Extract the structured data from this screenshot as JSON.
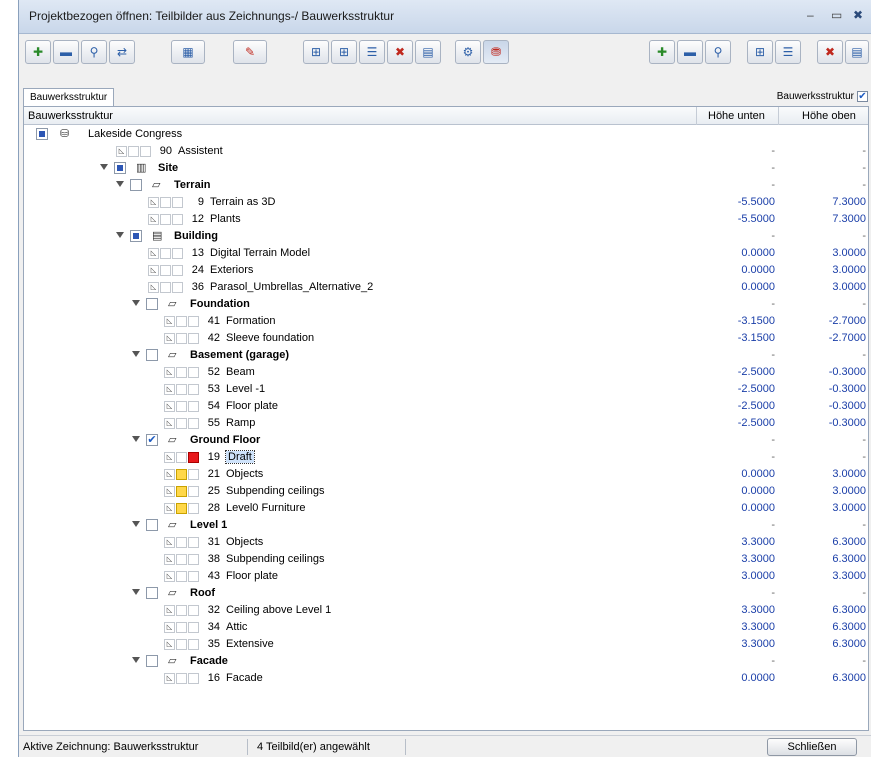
{
  "window": {
    "title": "Projektbezogen öffnen: Teilbilder aus Zeichnungs-/ Bauwerksstruktur",
    "minimize": "–",
    "maximize": "▭",
    "close": "✖"
  },
  "tabs": {
    "active": "Bauwerksstruktur",
    "right_label": "Bauwerksstruktur",
    "right_checked": "✔"
  },
  "columns": {
    "name": "Bauwerksstruktur",
    "low": "Höhe unten",
    "high": "Höhe oben"
  },
  "tree": [
    {
      "kind": "root",
      "label": "Lakeside Congress",
      "low": "",
      "high": ""
    },
    {
      "kind": "leaf",
      "level": 1,
      "num": "90",
      "label": "Assistent",
      "low": "-",
      "high": "-"
    },
    {
      "kind": "node",
      "level": 1,
      "label": "Site",
      "check": "filled",
      "low": "-",
      "high": "-"
    },
    {
      "kind": "node",
      "level": 2,
      "label": "Terrain",
      "check": "empty",
      "low": "-",
      "high": "-"
    },
    {
      "kind": "leaf",
      "level": 3,
      "num": "9",
      "label": "Terrain as 3D",
      "low": "-5.5000",
      "high": "7.3000"
    },
    {
      "kind": "leaf",
      "level": 3,
      "num": "12",
      "label": "Plants",
      "low": "-5.5000",
      "high": "7.3000"
    },
    {
      "kind": "node",
      "level": 2,
      "label": "Building",
      "check": "filled",
      "low": "-",
      "high": "-"
    },
    {
      "kind": "leaf",
      "level": 3,
      "num": "13",
      "label": "Digital Terrain Model",
      "low": "0.0000",
      "high": "3.0000"
    },
    {
      "kind": "leaf",
      "level": 3,
      "num": "24",
      "label": "Exteriors",
      "low": "0.0000",
      "high": "3.0000"
    },
    {
      "kind": "leaf",
      "level": 3,
      "num": "36",
      "label": "Parasol_Umbrellas_Alternative_2",
      "low": "0.0000",
      "high": "3.0000"
    },
    {
      "kind": "node",
      "level": 3,
      "label": "Foundation",
      "check": "empty",
      "low": "-",
      "high": "-"
    },
    {
      "kind": "leaf",
      "level": 4,
      "num": "41",
      "label": "Formation",
      "low": "-3.1500",
      "high": "-2.7000"
    },
    {
      "kind": "leaf",
      "level": 4,
      "num": "42",
      "label": "Sleeve foundation",
      "low": "-3.1500",
      "high": "-2.7000"
    },
    {
      "kind": "node",
      "level": 3,
      "label": "Basement (garage)",
      "check": "empty",
      "low": "-",
      "high": "-"
    },
    {
      "kind": "leaf",
      "level": 4,
      "num": "52",
      "label": "Beam",
      "low": "-2.5000",
      "high": "-0.3000"
    },
    {
      "kind": "leaf",
      "level": 4,
      "num": "53",
      "label": "Level -1",
      "low": "-2.5000",
      "high": "-0.3000"
    },
    {
      "kind": "leaf",
      "level": 4,
      "num": "54",
      "label": "Floor plate",
      "low": "-2.5000",
      "high": "-0.3000"
    },
    {
      "kind": "leaf",
      "level": 4,
      "num": "55",
      "label": "Ramp",
      "low": "-2.5000",
      "high": "-0.3000"
    },
    {
      "kind": "node",
      "level": 3,
      "label": "Ground Floor",
      "check": "checked",
      "low": "-",
      "high": "-"
    },
    {
      "kind": "leaf",
      "level": 4,
      "num": "19",
      "label": "Draft",
      "selected": true,
      "icon": "red",
      "low": "-",
      "high": "-"
    },
    {
      "kind": "leaf",
      "level": 4,
      "num": "21",
      "label": "Objects",
      "icon": "yel",
      "low": "0.0000",
      "high": "3.0000"
    },
    {
      "kind": "leaf",
      "level": 4,
      "num": "25",
      "label": "Subpending ceilings",
      "icon": "yel",
      "low": "0.0000",
      "high": "3.0000"
    },
    {
      "kind": "leaf",
      "level": 4,
      "num": "28",
      "label": "Level0 Furniture",
      "icon": "yel",
      "low": "0.0000",
      "high": "3.0000"
    },
    {
      "kind": "node",
      "level": 3,
      "label": "Level 1",
      "check": "empty",
      "low": "-",
      "high": "-"
    },
    {
      "kind": "leaf",
      "level": 4,
      "num": "31",
      "label": "Objects",
      "low": "3.3000",
      "high": "6.3000"
    },
    {
      "kind": "leaf",
      "level": 4,
      "num": "38",
      "label": "Subpending ceilings",
      "low": "3.3000",
      "high": "6.3000"
    },
    {
      "kind": "leaf",
      "level": 4,
      "num": "43",
      "label": "Floor plate",
      "low": "3.0000",
      "high": "3.3000"
    },
    {
      "kind": "node",
      "level": 3,
      "label": "Roof",
      "check": "empty",
      "low": "-",
      "high": "-"
    },
    {
      "kind": "leaf",
      "level": 4,
      "num": "32",
      "label": "Ceiling above Level 1",
      "low": "3.3000",
      "high": "6.3000"
    },
    {
      "kind": "leaf",
      "level": 4,
      "num": "34",
      "label": "Attic",
      "low": "3.3000",
      "high": "6.3000"
    },
    {
      "kind": "leaf",
      "level": 4,
      "num": "35",
      "label": "Extensive",
      "low": "3.3000",
      "high": "6.3000"
    },
    {
      "kind": "node",
      "level": 3,
      "label": "Facade",
      "check": "empty",
      "low": "-",
      "high": "-"
    },
    {
      "kind": "leaf",
      "level": 4,
      "num": "16",
      "label": "Facade",
      "low": "0.0000",
      "high": "6.3000"
    }
  ],
  "status": {
    "active_drawing": "Aktive Zeichnung: Bauwerksstruktur",
    "selected_count": "4 Teilbild(er) angewählt",
    "close_button": "Schließen"
  },
  "colors": {
    "value_blue": "#1a3ea8",
    "selection": "#cfe3fb"
  }
}
